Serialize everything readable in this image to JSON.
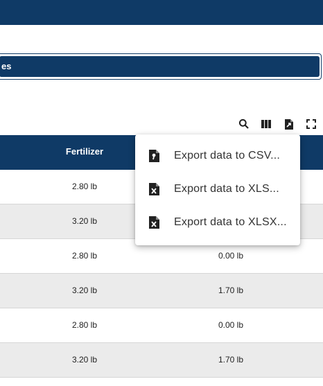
{
  "section": {
    "title_fragment": "es"
  },
  "toolbar": {
    "search_icon": "search-icon",
    "columns_icon": "view-columns-icon",
    "export_icon": "export-file-icon",
    "fullscreen_icon": "fullscreen-icon"
  },
  "table": {
    "headers": [
      "Fertilizer"
    ],
    "rows": [
      {
        "fertilizer": "2.80 lb",
        "other": ""
      },
      {
        "fertilizer": "3.20 lb",
        "other": ""
      },
      {
        "fertilizer": "2.80 lb",
        "other": "0.00 lb"
      },
      {
        "fertilizer": "3.20 lb",
        "other": "1.70 lb"
      },
      {
        "fertilizer": "2.80 lb",
        "other": "0.00 lb"
      },
      {
        "fertilizer": "3.20 lb",
        "other": "1.70 lb"
      }
    ]
  },
  "export_menu": {
    "items": [
      {
        "label": "Export data to CSV...",
        "icon": "csv-file-icon"
      },
      {
        "label": "Export data to XLS...",
        "icon": "xls-file-icon"
      },
      {
        "label": "Export data to XLSX...",
        "icon": "xlsx-file-icon"
      }
    ]
  },
  "colors": {
    "brand": "#0f3a66",
    "row_alt": "#ebebeb"
  }
}
